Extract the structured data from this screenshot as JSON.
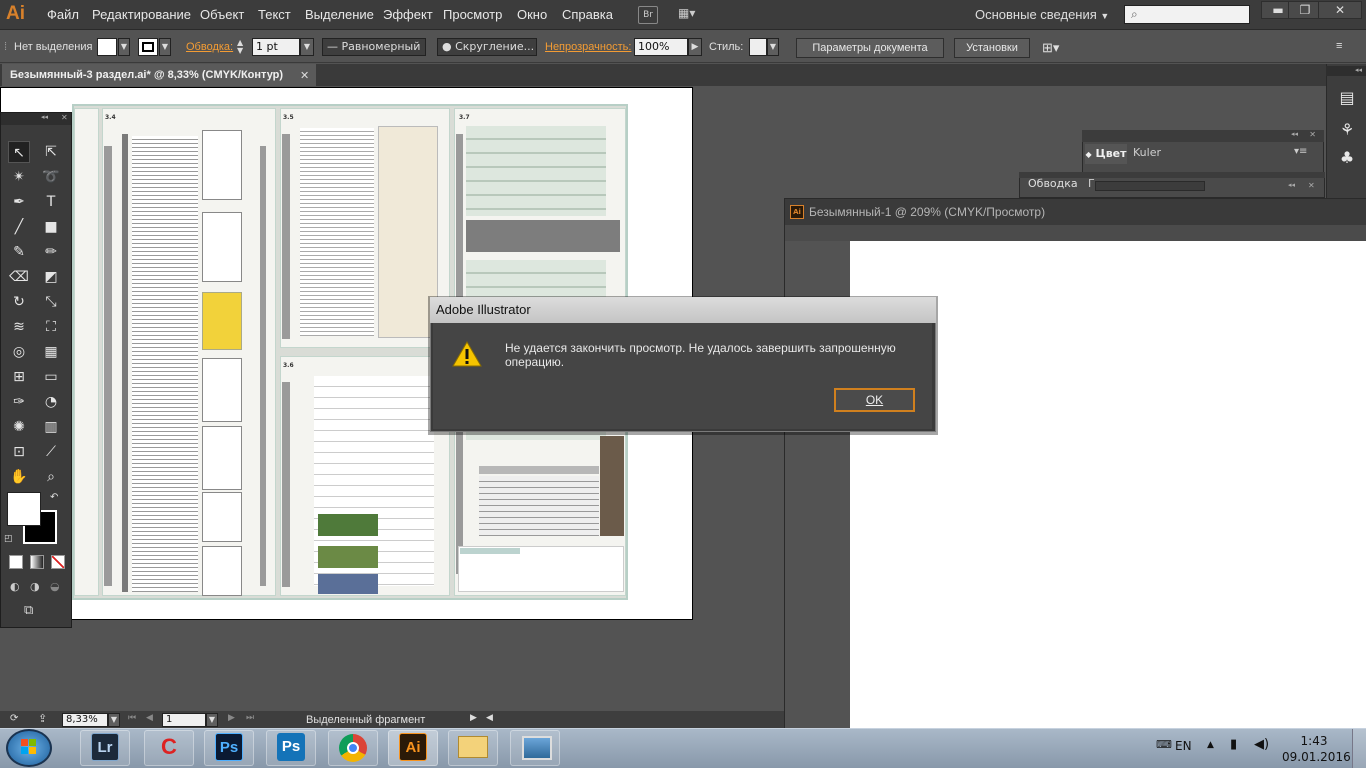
{
  "app": {
    "logo": "Ai"
  },
  "menu": {
    "items": [
      "Файл",
      "Редактирование",
      "Объект",
      "Текст",
      "Выделение",
      "Эффект",
      "Просмотр",
      "Окно",
      "Справка"
    ],
    "bridge": "Br",
    "workspace": "Основные сведения",
    "search_placeholder": "",
    "minimize": "▬",
    "restore": "❐",
    "close": "✕"
  },
  "control_bar": {
    "selection": "Нет выделения",
    "stroke_label": "Обводка:",
    "stroke_weight": "1 pt",
    "profile": "Равномерный",
    "brush": "Скругление...",
    "opacity_label": "Непрозрачность:",
    "opacity_value": "100%",
    "style_label": "Стиль:",
    "doc_settings": "Параметры документа",
    "preferences": "Установки"
  },
  "tabs": {
    "doc1": "Безымянный-3 раздел.ai* @ 8,33% (CMYK/Контур)",
    "close": "✕"
  },
  "doc2": {
    "title": "Безымянный-1 @ 209% (CMYK/Просмотр)",
    "ai_badge": "Ai"
  },
  "panels": {
    "color_tab": "Цвет",
    "kuler_tab": "Kuler",
    "stroke_tab": "Обводка",
    "second_tab": "Г"
  },
  "doc_sections": [
    "3.3",
    "3.4",
    "3.5",
    "3.6",
    "3.7"
  ],
  "dialog": {
    "title": "Adobe Illustrator",
    "message": "Не удается закончить просмотр. Не удалось завершить запрошенную операцию.",
    "ok": "OK"
  },
  "status": {
    "zoom": "8,33%",
    "page": "1",
    "text": "Выделенный фрагмент"
  },
  "taskbar": {
    "apps": [
      "Lr",
      "Ps",
      "Ps",
      "Ai"
    ],
    "lang": "EN",
    "time": "1:43",
    "date": "09.01.2016"
  },
  "colors": {
    "accent": "#d8812b",
    "orange_label": "#f39c34",
    "ok_border": "#d0801e"
  }
}
